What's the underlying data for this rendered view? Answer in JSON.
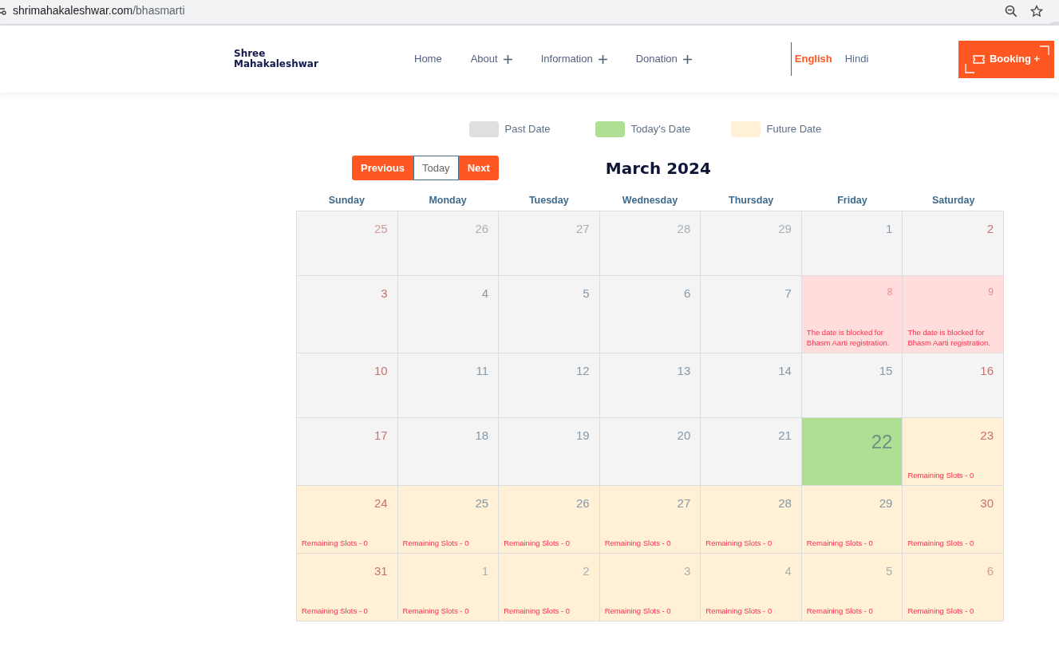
{
  "browser": {
    "url_host": "shrimahakaleshwar.com",
    "url_path": "/bhasmarti"
  },
  "header": {
    "logo_line_1": "Shree",
    "logo_line_2": "Mahakaleshwar",
    "nav": [
      {
        "label": "Home",
        "has_submenu": false
      },
      {
        "label": "About",
        "has_submenu": true
      },
      {
        "label": "Information",
        "has_submenu": true
      },
      {
        "label": "Donation",
        "has_submenu": true
      }
    ],
    "languages": [
      {
        "label": "English",
        "selected": true
      },
      {
        "label": "Hindi",
        "selected": false
      }
    ],
    "booking_button": "Booking +"
  },
  "legend": [
    {
      "label": "Past Date",
      "color": "#e0dfe0"
    },
    {
      "label": "Today's Date",
      "color": "#aedf92"
    },
    {
      "label": "Future Date",
      "color": "#fff0d6"
    }
  ],
  "calendar": {
    "title": "March 2024",
    "buttons": [
      {
        "label": "Previous",
        "kind": "filled"
      },
      {
        "label": "Today",
        "kind": "outline"
      },
      {
        "label": "Next",
        "kind": "filled"
      }
    ],
    "weekdays": [
      "Sunday",
      "Monday",
      "Tuesday",
      "Wednesday",
      "Thursday",
      "Friday",
      "Saturday"
    ],
    "weeks": [
      [
        {
          "day": "25",
          "kind": "past",
          "other_month": true
        },
        {
          "day": "26",
          "kind": "past",
          "other_month": true
        },
        {
          "day": "27",
          "kind": "past",
          "other_month": true
        },
        {
          "day": "28",
          "kind": "past",
          "other_month": true
        },
        {
          "day": "29",
          "kind": "past",
          "other_month": true
        },
        {
          "day": "1",
          "kind": "past",
          "other_month": false
        },
        {
          "day": "2",
          "kind": "past",
          "other_month": false
        }
      ],
      [
        {
          "day": "3",
          "kind": "past",
          "other_month": false
        },
        {
          "day": "4",
          "kind": "past",
          "other_month": false
        },
        {
          "day": "5",
          "kind": "past",
          "other_month": false
        },
        {
          "day": "6",
          "kind": "past",
          "other_month": false
        },
        {
          "day": "7",
          "kind": "past",
          "other_month": false
        },
        {
          "day": "8",
          "kind": "blocked",
          "other_month": false,
          "note": "The date is blocked for Bhasm Aarti registration."
        },
        {
          "day": "9",
          "kind": "blocked",
          "other_month": false,
          "note": "The date is blocked for Bhasm Aarti registration."
        }
      ],
      [
        {
          "day": "10",
          "kind": "past",
          "other_month": false
        },
        {
          "day": "11",
          "kind": "past",
          "other_month": false
        },
        {
          "day": "12",
          "kind": "past",
          "other_month": false
        },
        {
          "day": "13",
          "kind": "past",
          "other_month": false
        },
        {
          "day": "14",
          "kind": "past",
          "other_month": false
        },
        {
          "day": "15",
          "kind": "past",
          "other_month": false
        },
        {
          "day": "16",
          "kind": "past",
          "other_month": false
        }
      ],
      [
        {
          "day": "17",
          "kind": "past",
          "other_month": false
        },
        {
          "day": "18",
          "kind": "past",
          "other_month": false
        },
        {
          "day": "19",
          "kind": "past",
          "other_month": false
        },
        {
          "day": "20",
          "kind": "past",
          "other_month": false
        },
        {
          "day": "21",
          "kind": "past",
          "other_month": false
        },
        {
          "day": "22",
          "kind": "today",
          "other_month": false
        },
        {
          "day": "23",
          "kind": "future",
          "other_month": false,
          "note": "Remaining Slots - 0"
        }
      ],
      [
        {
          "day": "24",
          "kind": "future",
          "other_month": false,
          "note": "Remaining Slots - 0"
        },
        {
          "day": "25",
          "kind": "future",
          "other_month": false,
          "note": "Remaining Slots - 0"
        },
        {
          "day": "26",
          "kind": "future",
          "other_month": false,
          "note": "Remaining Slots - 0"
        },
        {
          "day": "27",
          "kind": "future",
          "other_month": false,
          "note": "Remaining Slots - 0"
        },
        {
          "day": "28",
          "kind": "future",
          "other_month": false,
          "note": "Remaining Slots - 0"
        },
        {
          "day": "29",
          "kind": "future",
          "other_month": false,
          "note": "Remaining Slots - 0"
        },
        {
          "day": "30",
          "kind": "future",
          "other_month": false,
          "note": "Remaining Slots - 0"
        }
      ],
      [
        {
          "day": "31",
          "kind": "future",
          "other_month": false,
          "note": "Remaining Slots - 0"
        },
        {
          "day": "1",
          "kind": "future",
          "other_month": true,
          "note": "Remaining Slots - 0"
        },
        {
          "day": "2",
          "kind": "future",
          "other_month": true,
          "note": "Remaining Slots - 0"
        },
        {
          "day": "3",
          "kind": "future",
          "other_month": true,
          "note": "Remaining Slots - 0"
        },
        {
          "day": "4",
          "kind": "future",
          "other_month": true,
          "note": "Remaining Slots - 0"
        },
        {
          "day": "5",
          "kind": "future",
          "other_month": true,
          "note": "Remaining Slots - 0"
        },
        {
          "day": "6",
          "kind": "future",
          "other_month": true,
          "note": "Remaining Slots - 0"
        }
      ]
    ]
  }
}
